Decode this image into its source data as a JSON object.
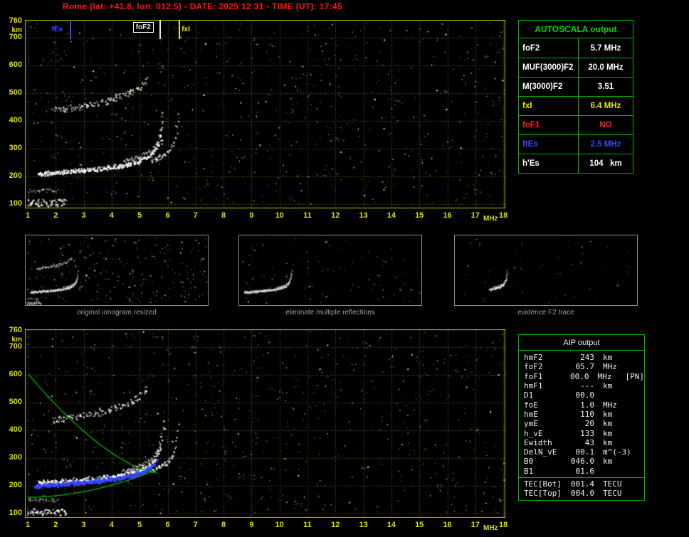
{
  "header": {
    "title": "Rome (lat: +41.8, lon: 012.5) - DATE: 2025 12 31 - TIME (UT): 17:45"
  },
  "colors": {
    "border": "#c0c000",
    "grid": "#676700",
    "axis": "#e0e000",
    "green": "#00c000",
    "blue": "#3448ff",
    "white": "#ffffff",
    "yellow": "#e8e800",
    "red": "#ff2020"
  },
  "ionogram": {
    "unit_y": "km",
    "unit_x": "MHz",
    "y_ticks": [
      760,
      700,
      600,
      500,
      400,
      300,
      200,
      100
    ],
    "x_ticks": [
      1,
      2,
      3,
      4,
      5,
      6,
      7,
      8,
      9,
      10,
      11,
      12,
      13,
      14,
      15,
      16,
      17,
      18
    ],
    "markers": [
      {
        "label": "fEs",
        "freq": 2.5,
        "color": "#3448ff",
        "style": "text-left"
      },
      {
        "label": "foF2",
        "freq": 5.7,
        "color": "#e8e8e8",
        "style": "boxed"
      },
      {
        "label": "fxI",
        "freq": 6.4,
        "color": "#e8e800",
        "style": "text-right"
      }
    ]
  },
  "autoscala_table": {
    "title": "AUTOSCALA output",
    "rows": [
      {
        "param": "foF2",
        "value": "5.7 MHz",
        "color": "#ffffff"
      },
      {
        "param": "MUF(3000)F2",
        "value": "20.0 MHz",
        "color": "#ffffff"
      },
      {
        "param": "M(3000)F2",
        "value": "3.51",
        "color": "#ffffff"
      },
      {
        "param": "fxI",
        "value": "6.4 MHz",
        "color": "#e8e800"
      },
      {
        "param": "foF1",
        "value": "NO",
        "color": "#ff2020"
      },
      {
        "param": "ftEs",
        "value": "2.5 MHz",
        "color": "#3448ff"
      },
      {
        "param": "h'Es",
        "value": "104   km",
        "color": "#ffffff"
      }
    ]
  },
  "thumbnails": [
    {
      "caption": "original ionogram resized"
    },
    {
      "caption": "eliminate multiple reflections"
    },
    {
      "caption": "evidence F2 trace"
    }
  ],
  "aip_table": {
    "title": "AIP output",
    "rows": [
      {
        "param": "hmF2",
        "value": "243",
        "unit": "km",
        "note": ""
      },
      {
        "param": "foF2",
        "value": "05.7",
        "unit": "MHz",
        "note": ""
      },
      {
        "param": "foF1",
        "value": "00.0",
        "unit": "MHz",
        "note": "[PN]"
      },
      {
        "param": "hmF1",
        "value": "---",
        "unit": "km",
        "note": ""
      },
      {
        "param": "D1",
        "value": "00.0",
        "unit": "",
        "note": ""
      },
      {
        "param": "foE",
        "value": "1.0",
        "unit": "MHz",
        "note": ""
      },
      {
        "param": "hmE",
        "value": "110",
        "unit": "km",
        "note": ""
      },
      {
        "param": "ymE",
        "value": "20",
        "unit": "km",
        "note": ""
      },
      {
        "param": "h_vE",
        "value": "133",
        "unit": "km",
        "note": ""
      },
      {
        "param": "Ewidth",
        "value": "43",
        "unit": "km",
        "note": ""
      },
      {
        "param": "DelN_vE",
        "value": "00.1",
        "unit": "m^(-3)",
        "note": ""
      },
      {
        "param": "B0",
        "value": "046.0",
        "unit": "km",
        "note": ""
      },
      {
        "param": "B1",
        "value": "01.6",
        "unit": "",
        "note": ""
      }
    ],
    "tec_rows": [
      {
        "param": "TEC[Bot]",
        "value": "001.4",
        "unit": "TECU"
      },
      {
        "param": "TEC[Top]",
        "value": "004.0",
        "unit": "TECU"
      }
    ]
  }
}
